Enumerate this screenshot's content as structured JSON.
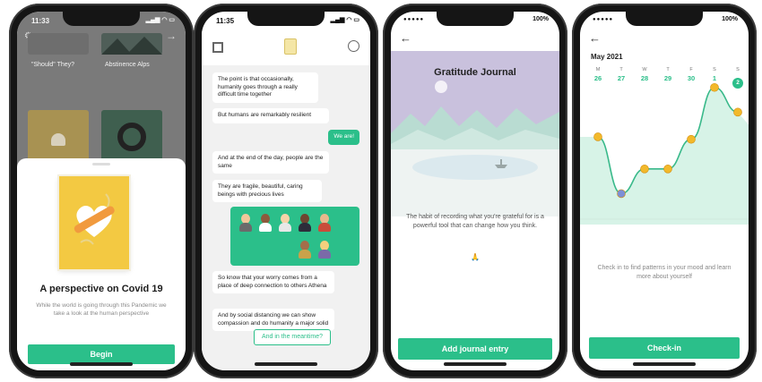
{
  "screen1": {
    "time": "11:33",
    "cards": [
      {
        "label": "\"Should\" They?"
      },
      {
        "label": "Abstinence Alps"
      }
    ],
    "title": "A perspective on Covid 19",
    "description": "While the world is going through this Pandemic we take a look at the human perspective",
    "button": "Begin",
    "colors": {
      "poster": "#f3c942",
      "accent": "#2bbf8a"
    }
  },
  "screen2": {
    "time": "11:35",
    "messages": [
      {
        "from": "bot",
        "text": "The point is that occasionally, humanity goes through a really difficult time together"
      },
      {
        "from": "bot",
        "text": "But humans are remarkably resilient"
      },
      {
        "from": "user",
        "text": "We are!"
      },
      {
        "from": "bot",
        "text": "And at the end of the day, people are the same"
      },
      {
        "from": "bot",
        "text": "They are fragile, beautiful, caring beings with precious lives"
      },
      {
        "from": "bot",
        "text": "So know that your worry comes from a place of deep connection to others Athena"
      },
      {
        "from": "bot",
        "text": "And by social distancing we can show compassion and do humanity a major solid"
      }
    ],
    "reply_button": "And in the meantime?"
  },
  "screen3": {
    "battery": "100%",
    "title": "Gratitude Journal",
    "description": "The habit of recording what you're grateful for is a powerful tool that can change how you think.",
    "emoji": "🙏",
    "button": "Add journal entry"
  },
  "screen4": {
    "battery": "100%",
    "month": "May 2021",
    "days": [
      {
        "letter": "M",
        "num": "26"
      },
      {
        "letter": "T",
        "num": "27"
      },
      {
        "letter": "W",
        "num": "28"
      },
      {
        "letter": "T",
        "num": "29"
      },
      {
        "letter": "F",
        "num": "30"
      },
      {
        "letter": "S",
        "num": "1"
      },
      {
        "letter": "S",
        "num": "2",
        "selected": true
      }
    ],
    "mood_levels": [
      0.58,
      0.12,
      0.32,
      0.32,
      0.56,
      0.98,
      0.78
    ],
    "description": "Check in to find patterns in your mood and learn more about yourself",
    "button": "Check-in"
  }
}
